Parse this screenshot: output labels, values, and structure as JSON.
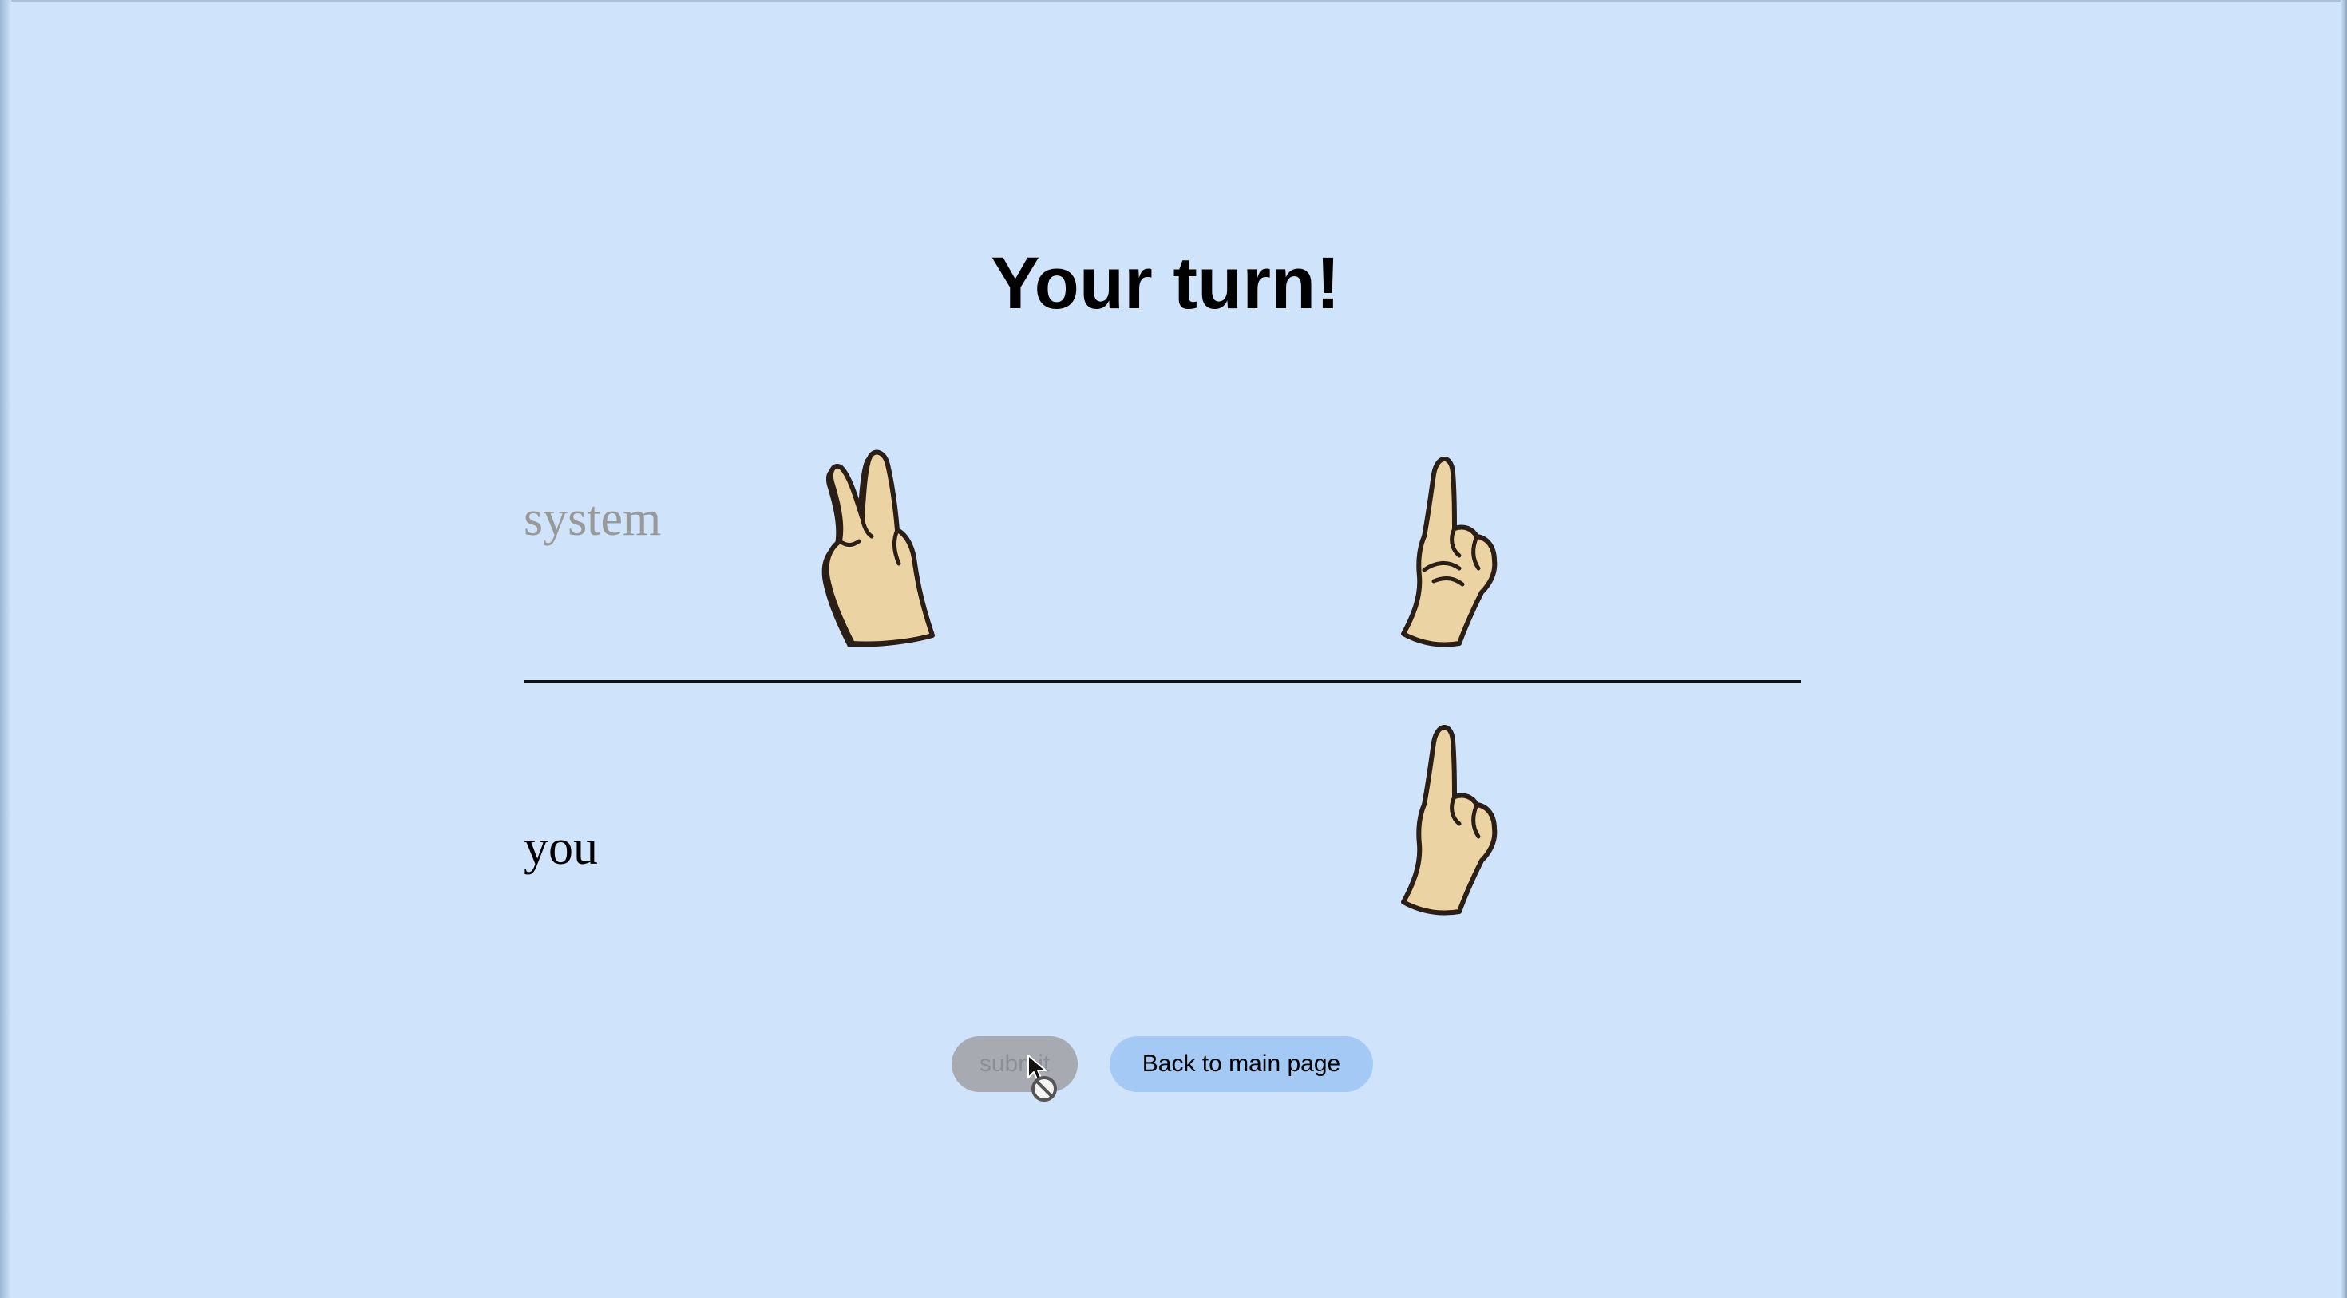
{
  "title": "Your turn!",
  "rows": {
    "system": {
      "label": "system",
      "hands": [
        "two-fingers-hand-icon",
        "one-finger-hand-icon"
      ]
    },
    "you": {
      "label": "you",
      "hands": [
        "one-finger-hand-icon"
      ]
    }
  },
  "buttons": {
    "submit_label": "submit",
    "back_label": "Back to main page"
  },
  "colors": {
    "background": "#cfe3fa",
    "skin": "#ecd3a4",
    "outline": "#2a1e16",
    "submit_disabled": "#a7abb1",
    "back_button": "#a4c9f5",
    "system_label": "#999999"
  },
  "cursor": "not-allowed-cursor-icon"
}
